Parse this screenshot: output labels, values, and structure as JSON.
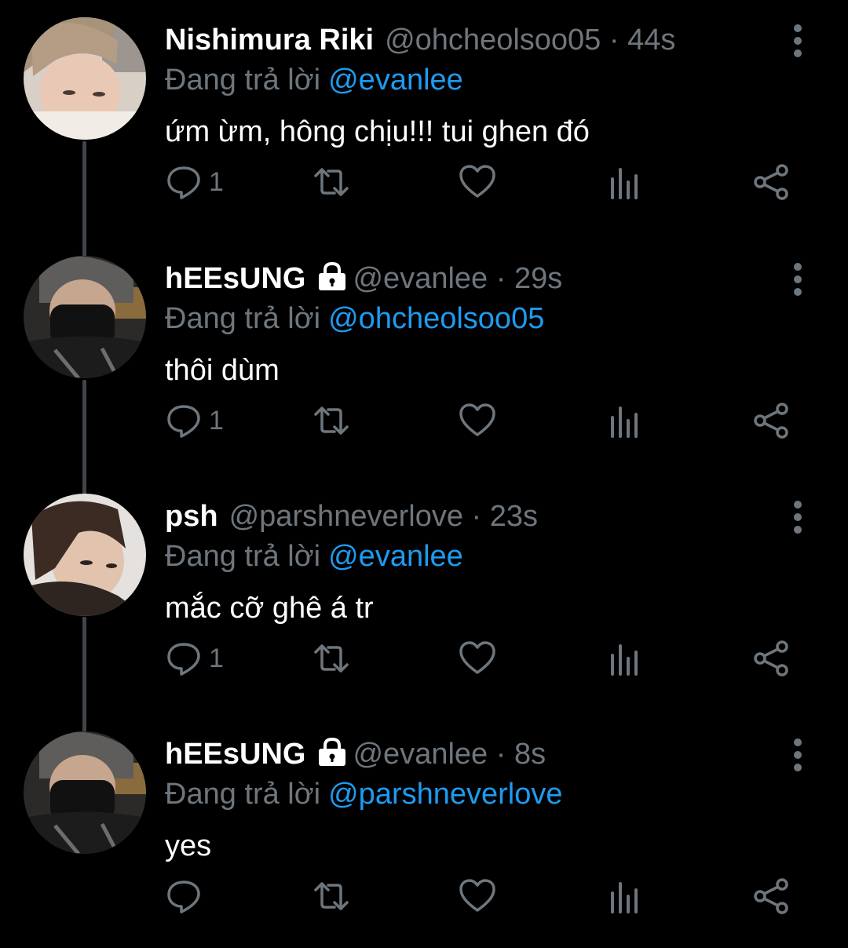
{
  "colors": {
    "background": "#000000",
    "secondary_text": "#6e767d",
    "link": "#1d9bf0",
    "thread_line": "#3f4549"
  },
  "tweets": [
    {
      "display_name": "Nishimura Riki",
      "protected": false,
      "handle": "@ohcheolsoo05",
      "separator": "·",
      "time": "44s",
      "reply_prefix": "Đang trả lời",
      "reply_to": "@evanlee",
      "text": "ứm ừm, hông chịu!!! tui ghen đó",
      "reply_count": "1",
      "avatar_icon": "profile-photo-light-hair"
    },
    {
      "display_name": "hEEsUNG",
      "protected": true,
      "handle": "@evanlee",
      "separator": "·",
      "time": "29s",
      "reply_prefix": "Đang trả lời",
      "reply_to": "@ohcheolsoo05",
      "text": "thôi dùm",
      "reply_count": "1",
      "avatar_icon": "profile-photo-masked"
    },
    {
      "display_name": "psh",
      "protected": false,
      "handle": "@parshneverlove",
      "separator": "·",
      "time": "23s",
      "reply_prefix": "Đang trả lời",
      "reply_to": "@evanlee",
      "text": "mắc cỡ ghê á tr",
      "reply_count": "1",
      "avatar_icon": "profile-photo-dark-hair"
    },
    {
      "display_name": "hEEsUNG",
      "protected": true,
      "handle": "@evanlee",
      "separator": "·",
      "time": "8s",
      "reply_prefix": "Đang trả lời",
      "reply_to": "@parshneverlove",
      "text": "yes",
      "reply_count": "",
      "avatar_icon": "profile-photo-masked"
    }
  ]
}
